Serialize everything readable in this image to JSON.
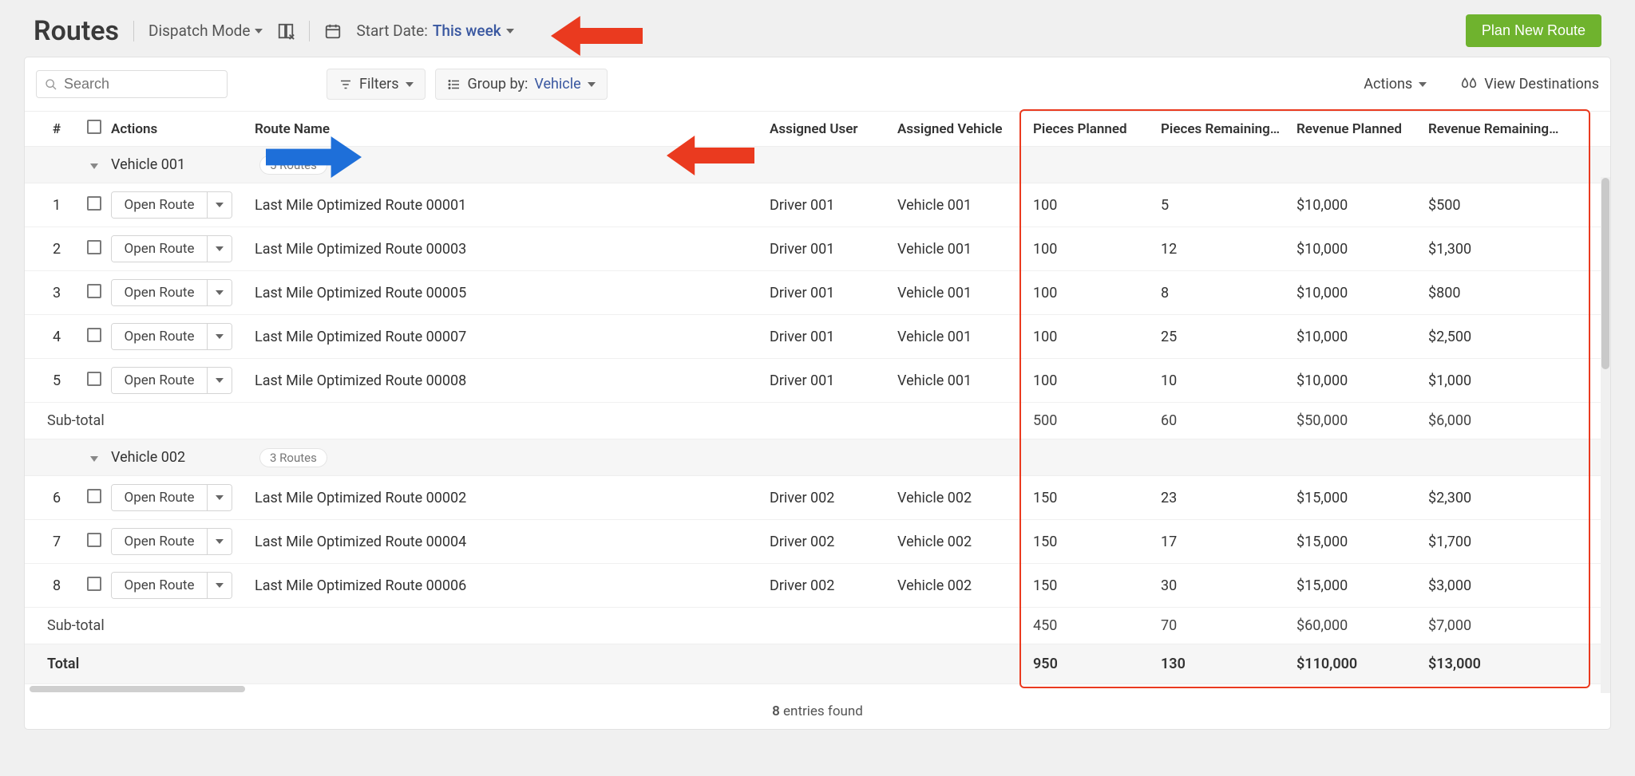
{
  "header": {
    "title": "Routes",
    "dispatch_mode_label": "Dispatch Mode",
    "start_date_label": "Start Date:",
    "start_date_value": "This week",
    "plan_new_route": "Plan New Route"
  },
  "toolbar": {
    "search_placeholder": "Search",
    "filters_label": "Filters",
    "group_by_label": "Group by:",
    "group_by_value": "Vehicle",
    "actions_label": "Actions",
    "view_destinations": "View Destinations"
  },
  "columns": {
    "num": "#",
    "actions": "Actions",
    "route_name": "Route Name",
    "assigned_user": "Assigned User",
    "assigned_vehicle": "Assigned Vehicle",
    "pieces_planned": "Pieces Planned",
    "pieces_remaining": "Pieces Remaining…",
    "revenue_planned": "Revenue Planned",
    "revenue_remaining": "Revenue Remaining…"
  },
  "open_route_label": "Open Route",
  "groups": [
    {
      "name": "Vehicle 001",
      "badge": "5 Routes",
      "rows": [
        {
          "n": "1",
          "name": "Last Mile Optimized Route 00001",
          "user": "Driver 001",
          "vehicle": "Vehicle 001",
          "pp": "100",
          "pr": "5",
          "rp": "$10,000",
          "rr": "$500"
        },
        {
          "n": "2",
          "name": "Last Mile Optimized Route 00003",
          "user": "Driver 001",
          "vehicle": "Vehicle 001",
          "pp": "100",
          "pr": "12",
          "rp": "$10,000",
          "rr": "$1,300"
        },
        {
          "n": "3",
          "name": "Last Mile Optimized Route 00005",
          "user": "Driver 001",
          "vehicle": "Vehicle 001",
          "pp": "100",
          "pr": "8",
          "rp": "$10,000",
          "rr": "$800"
        },
        {
          "n": "4",
          "name": "Last Mile Optimized Route 00007",
          "user": "Driver 001",
          "vehicle": "Vehicle 001",
          "pp": "100",
          "pr": "25",
          "rp": "$10,000",
          "rr": "$2,500"
        },
        {
          "n": "5",
          "name": "Last Mile Optimized Route 00008",
          "user": "Driver 001",
          "vehicle": "Vehicle 001",
          "pp": "100",
          "pr": "10",
          "rp": "$10,000",
          "rr": "$1,000"
        }
      ],
      "subtotal": {
        "label": "Sub-total",
        "pp": "500",
        "pr": "60",
        "rp": "$50,000",
        "rr": "$6,000"
      }
    },
    {
      "name": "Vehicle 002",
      "badge": "3 Routes",
      "rows": [
        {
          "n": "6",
          "name": "Last Mile Optimized Route 00002",
          "user": "Driver 002",
          "vehicle": "Vehicle 002",
          "pp": "150",
          "pr": "23",
          "rp": "$15,000",
          "rr": "$2,300"
        },
        {
          "n": "7",
          "name": "Last Mile Optimized Route 00004",
          "user": "Driver 002",
          "vehicle": "Vehicle 002",
          "pp": "150",
          "pr": "17",
          "rp": "$15,000",
          "rr": "$1,700"
        },
        {
          "n": "8",
          "name": "Last Mile Optimized Route 00006",
          "user": "Driver 002",
          "vehicle": "Vehicle 002",
          "pp": "150",
          "pr": "30",
          "rp": "$15,000",
          "rr": "$3,000"
        }
      ],
      "subtotal": {
        "label": "Sub-total",
        "pp": "450",
        "pr": "70",
        "rp": "$60,000",
        "rr": "$7,000"
      }
    }
  ],
  "total": {
    "label": "Total",
    "pp": "950",
    "pr": "130",
    "rp": "$110,000",
    "rr": "$13,000"
  },
  "footer": {
    "count": "8",
    "text": "entries found"
  }
}
